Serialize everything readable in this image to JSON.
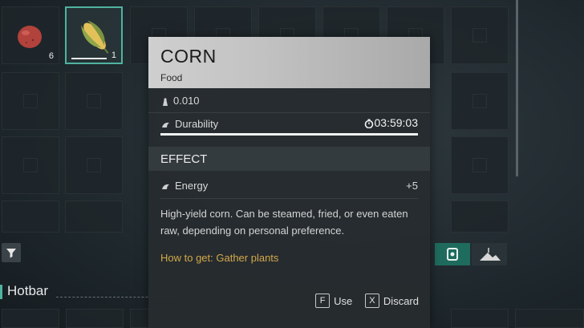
{
  "inventory": {
    "slots": [
      {
        "item": "tomato-icon",
        "count": "6"
      },
      {
        "item": "corn-icon",
        "count": "1",
        "selected": true
      }
    ]
  },
  "hotbar": {
    "label": "Hotbar"
  },
  "tooltip": {
    "title": "CORN",
    "category": "Food",
    "weight": "0.010",
    "durability_label": "Durability",
    "durability_time": "03:59:03",
    "durability_fraction": 1.0,
    "effect_header": "EFFECT",
    "effects": [
      {
        "name": "Energy",
        "value": "+5"
      }
    ],
    "description": "High-yield corn. Can be steamed, fried, or even eaten raw, depending on personal preference.",
    "how_to_get": "How to get: Gather plants",
    "actions": [
      {
        "key": "F",
        "label": "Use"
      },
      {
        "key": "X",
        "label": "Discard"
      }
    ]
  },
  "colors": {
    "accent": "#4fb3a0",
    "how_to_get": "#d2a94a"
  }
}
